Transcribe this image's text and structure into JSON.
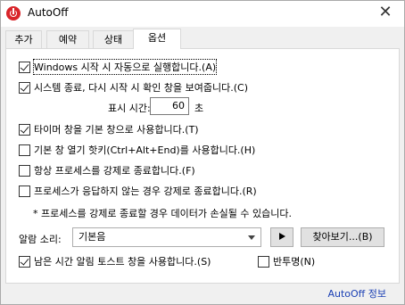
{
  "window": {
    "title": "AutoOff",
    "close_glyph": "✕"
  },
  "tabs": [
    {
      "label": "추가"
    },
    {
      "label": "예약"
    },
    {
      "label": "상태"
    },
    {
      "label": "옵션"
    }
  ],
  "active_tab": "옵션",
  "options": {
    "autostart": {
      "label": "Windows 시작 시 자동으로 실행합니다.(A)",
      "checked": true
    },
    "confirm_on_shutdown": {
      "label": "시스템 종료, 다시 시작 시 확인 창을 보여줍니다.(C)",
      "checked": true
    },
    "display_time": {
      "label": "표시 시간:",
      "value": "60",
      "unit": "초"
    },
    "timer_window": {
      "label": "타이머 창을 기본 창으로 사용합니다.(T)",
      "checked": true
    },
    "hotkey": {
      "label": "기본 창 열기 핫키(Ctrl+Alt+End)를 사용합니다.(H)",
      "checked": false
    },
    "force_close": {
      "label": "항상 프로세스를 강제로 종료합니다.(F)",
      "checked": false
    },
    "force_unresponsive": {
      "label": "프로세스가 응답하지 않는 경우 강제로 종료합니다.(R)",
      "checked": false
    },
    "warning_note": "* 프로세스를 강제로 종료할 경우 데이터가 손실될 수 있습니다.",
    "alarm_sound": {
      "label": "알람 소리:",
      "selected": "기본음",
      "browse_label": "찾아보기...(B)"
    },
    "toast": {
      "label": "남은 시간 알림 토스트 창을 사용합니다.(S)",
      "checked": true
    },
    "translucent": {
      "label": "반투명(N)",
      "checked": false
    }
  },
  "footer": {
    "info_link": "AutoOff 정보"
  },
  "icons": {
    "app": "power-icon",
    "play": "play-icon",
    "dropdown": "chevron-down-icon"
  },
  "colors": {
    "app_icon": "#d9252a",
    "link": "#1a3fb4"
  }
}
